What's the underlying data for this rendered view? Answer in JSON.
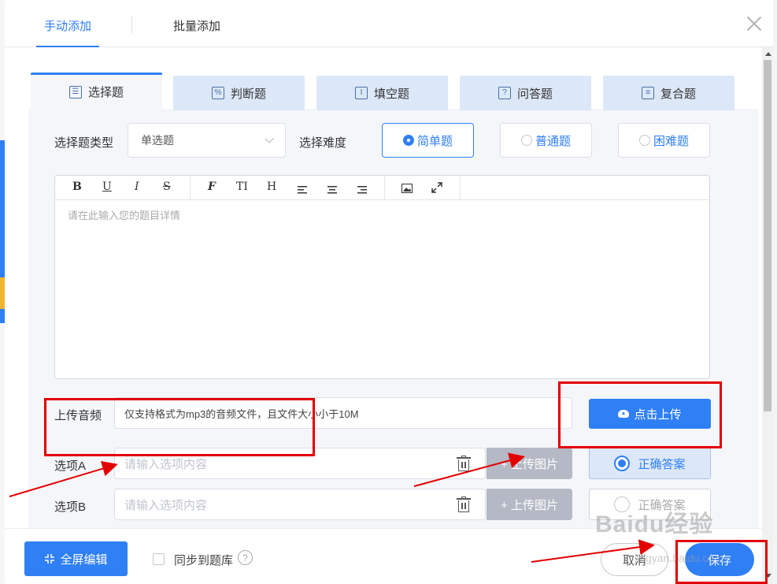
{
  "top_tabs": {
    "manual": "手动添加",
    "batch": "批量添加"
  },
  "question_tabs": [
    {
      "label": "选择题",
      "icon": "list-icon",
      "glyph": "☰"
    },
    {
      "label": "判断题",
      "icon": "percent-icon",
      "glyph": "%"
    },
    {
      "label": "填空题",
      "icon": "text-cursor-icon",
      "glyph": "I"
    },
    {
      "label": "问答题",
      "icon": "question-icon",
      "glyph": "?"
    },
    {
      "label": "复合题",
      "icon": "compound-icon",
      "glyph": "≡"
    }
  ],
  "form": {
    "type_label": "选择题类型",
    "type_value": "单选题",
    "difficulty_label": "选择难度",
    "difficulty_options": [
      "简单题",
      "普通题",
      "困难题"
    ],
    "difficulty_selected": "简单题"
  },
  "editor": {
    "toolbar": [
      "B",
      "U",
      "I",
      "S",
      "F",
      "TI",
      "H"
    ],
    "placeholder": "请在此输入您的题目详情"
  },
  "audio": {
    "label": "上传音频",
    "hint": "仅支持格式为mp3的音频文件，且文件大小小于10M",
    "upload_button": "点击上传"
  },
  "options": [
    {
      "label": "选项A",
      "placeholder": "请输入选项内容",
      "image_button": "+ 上传图片",
      "correct_label": "正确答案",
      "correct": true
    },
    {
      "label": "选项B",
      "placeholder": "请输入选项内容",
      "image_button": "+ 上传图片",
      "correct_label": "正确答案",
      "correct": false
    }
  ],
  "footer": {
    "fullscreen_button": "全屏编辑",
    "sync_label": "同步到题库",
    "help": "?",
    "cancel_button": "取消",
    "save_button": "保存"
  },
  "watermark": {
    "main": "Baidu经验",
    "sub": "jingyan.baidu.com"
  },
  "colors": {
    "accent": "#2f7ff5",
    "annotation": "#e30000"
  }
}
